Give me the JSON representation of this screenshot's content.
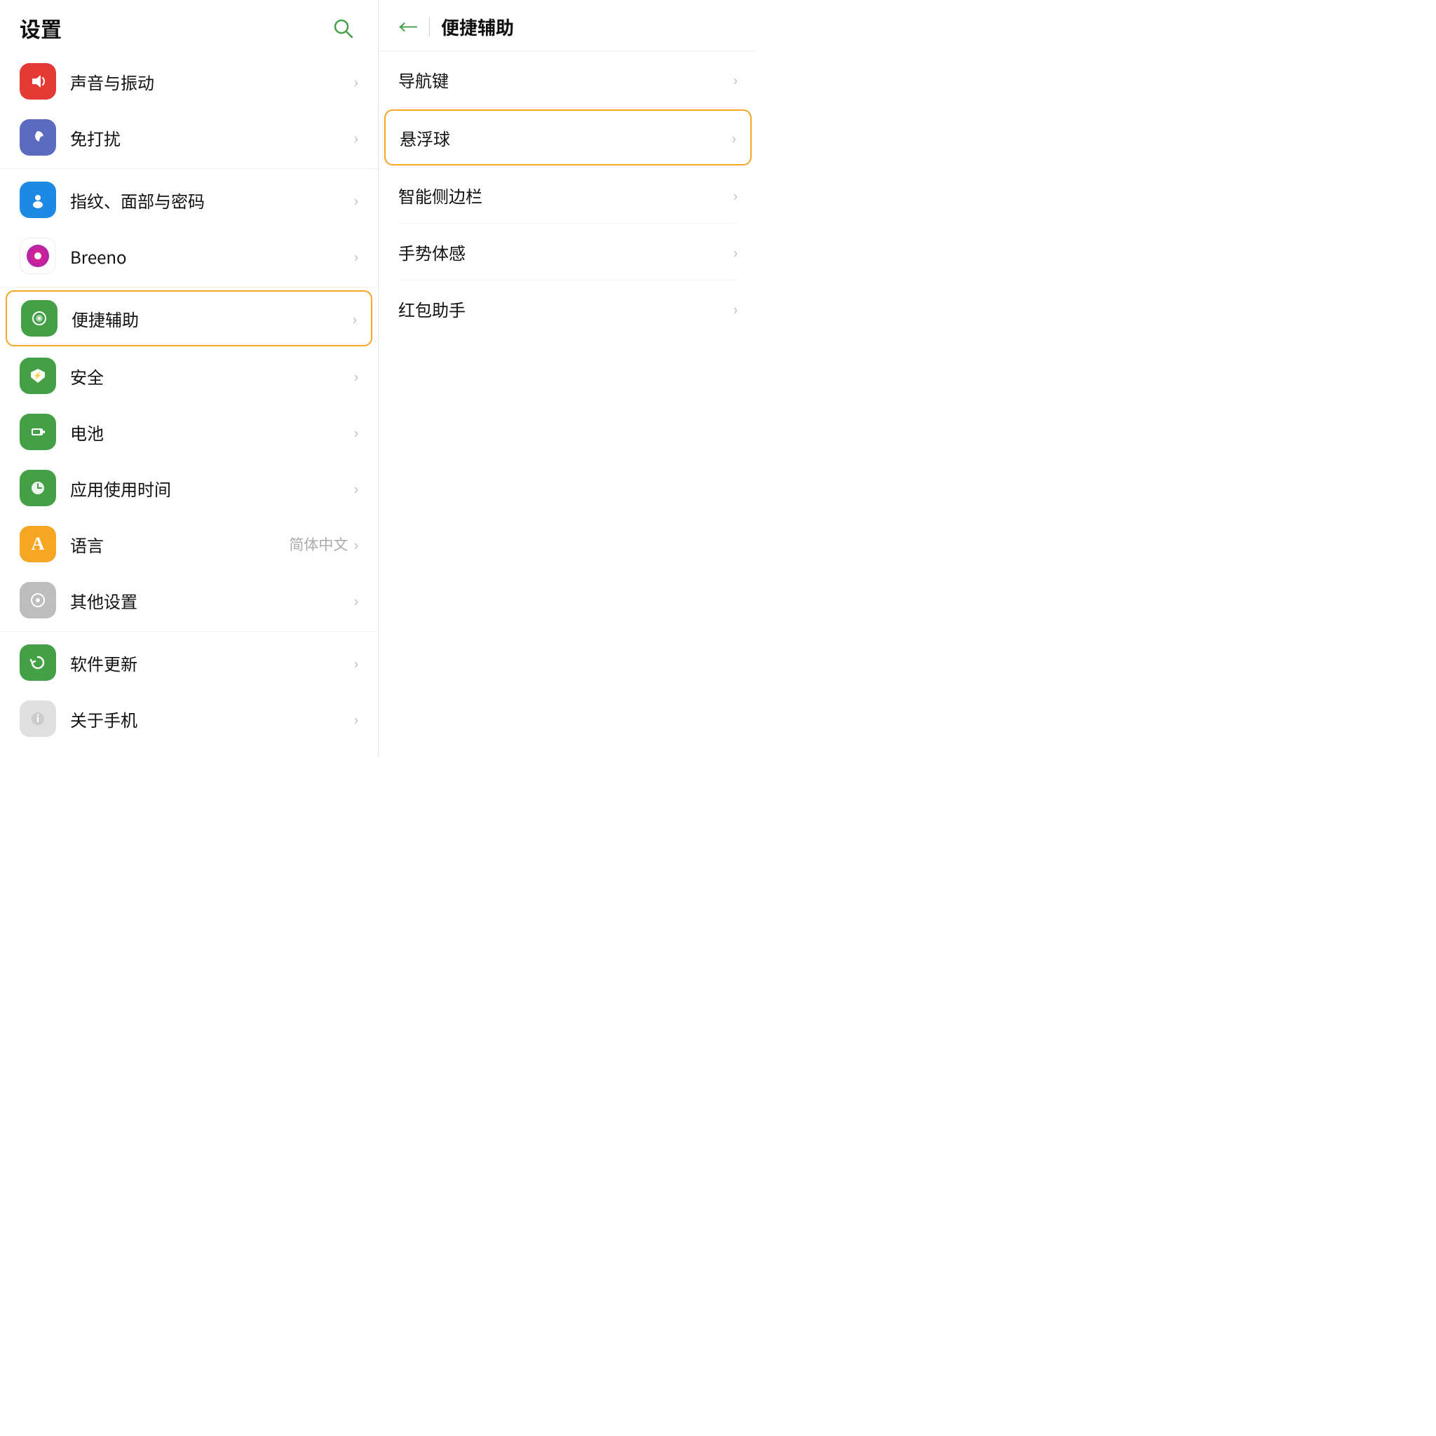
{
  "left": {
    "title": "设置",
    "search_aria": "搜索",
    "items": [
      {
        "id": "sound",
        "label": "声音与振动",
        "icon_type": "sound",
        "icon_char": "🔊",
        "active": false,
        "has_chevron": true,
        "value": ""
      },
      {
        "id": "dnd",
        "label": "免打扰",
        "icon_type": "dnd",
        "icon_char": "🌙",
        "active": false,
        "has_chevron": true,
        "value": ""
      },
      {
        "id": "fingerprint",
        "label": "指纹、面部与密码",
        "icon_type": "fingerprint",
        "icon_char": "👤",
        "active": false,
        "has_chevron": true,
        "value": ""
      },
      {
        "id": "breeno",
        "label": "Breeno",
        "icon_type": "breeno",
        "active": false,
        "has_chevron": true,
        "value": ""
      },
      {
        "id": "shortcut",
        "label": "便捷辅助",
        "icon_type": "shortcut",
        "icon_char": "⚙",
        "active": true,
        "has_chevron": true,
        "value": ""
      },
      {
        "id": "security",
        "label": "安全",
        "icon_type": "security",
        "icon_char": "⚡",
        "active": false,
        "has_chevron": true,
        "value": ""
      },
      {
        "id": "battery",
        "label": "电池",
        "icon_type": "battery",
        "icon_char": "🔋",
        "active": false,
        "has_chevron": true,
        "value": ""
      },
      {
        "id": "apptime",
        "label": "应用使用时间",
        "icon_type": "apptime",
        "icon_char": "⏱",
        "active": false,
        "has_chevron": true,
        "value": ""
      },
      {
        "id": "language",
        "label": "语言",
        "icon_type": "language",
        "icon_char": "A",
        "active": false,
        "has_chevron": true,
        "value": "简体中文"
      },
      {
        "id": "other",
        "label": "其他设置",
        "icon_type": "other",
        "icon_char": "◉",
        "active": false,
        "has_chevron": true,
        "value": ""
      },
      {
        "id": "update",
        "label": "软件更新",
        "icon_type": "update",
        "icon_char": "↻",
        "active": false,
        "has_chevron": true,
        "value": ""
      },
      {
        "id": "about",
        "label": "关于手机",
        "icon_type": "about",
        "icon_char": "ℹ",
        "active": false,
        "has_chevron": true,
        "value": ""
      }
    ],
    "dividers_after": [
      "dnd",
      "breeno",
      "other"
    ]
  },
  "right": {
    "back_label": "←",
    "title": "便捷辅助",
    "items": [
      {
        "id": "nav",
        "label": "导航键",
        "active": false
      },
      {
        "id": "floatball",
        "label": "悬浮球",
        "active": true
      },
      {
        "id": "sidebar",
        "label": "智能侧边栏",
        "active": false
      },
      {
        "id": "gesture",
        "label": "手势体感",
        "active": false
      },
      {
        "id": "redpacket",
        "label": "红包助手",
        "active": false
      }
    ],
    "dividers_after": [
      "nav",
      "sidebar",
      "gesture"
    ]
  }
}
